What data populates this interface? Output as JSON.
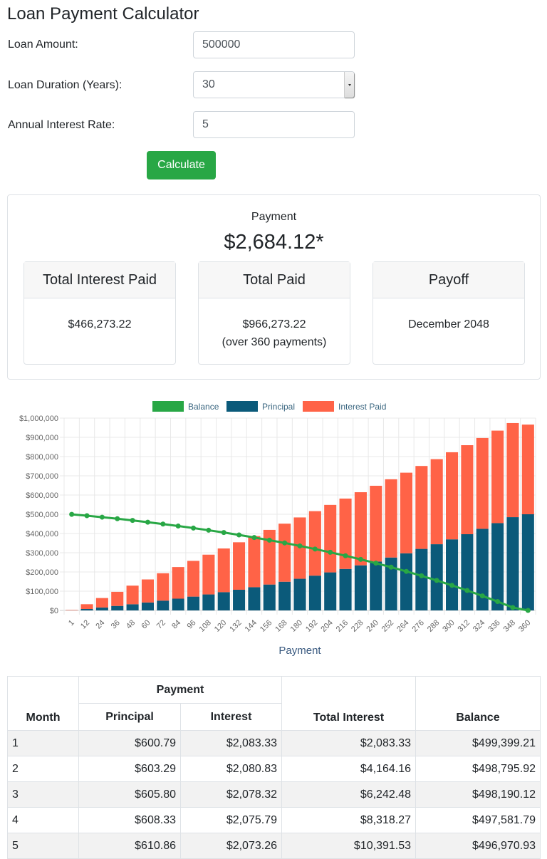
{
  "title": "Loan Payment Calculator",
  "form": {
    "amount_label": "Loan Amount:",
    "amount_value": "500000",
    "duration_label": "Loan Duration (Years):",
    "duration_value": "30",
    "rate_label": "Annual Interest Rate:",
    "rate_value": "5",
    "calculate_label": "Calculate"
  },
  "summary": {
    "payment_label": "Payment",
    "payment_value": "$2,684.12*",
    "cards": [
      {
        "header": "Total Interest Paid",
        "line1": "$466,273.22",
        "line2": ""
      },
      {
        "header": "Total Paid",
        "line1": "$966,273.22",
        "line2": "(over 360 payments)"
      },
      {
        "header": "Payoff",
        "line1": "December 2048",
        "line2": ""
      }
    ]
  },
  "chart_data": {
    "type": "bar",
    "stacked": true,
    "xlabel": "Payment",
    "ylabel": "",
    "ylim": [
      0,
      1000000
    ],
    "yticks": [
      "$0",
      "$100,000",
      "$200,000",
      "$300,000",
      "$400,000",
      "$500,000",
      "$600,000",
      "$700,000",
      "$800,000",
      "$900,000",
      "$1,000,000"
    ],
    "legend": "top",
    "grid": true,
    "categories": [
      "1",
      "12",
      "24",
      "36",
      "48",
      "60",
      "72",
      "84",
      "96",
      "108",
      "120",
      "132",
      "144",
      "156",
      "168",
      "180",
      "192",
      "204",
      "216",
      "228",
      "240",
      "252",
      "264",
      "276",
      "288",
      "300",
      "312",
      "324",
      "336",
      "348",
      "360"
    ],
    "series": [
      {
        "name": "Balance",
        "type": "line",
        "color": "#28a745",
        "values": [
          499399,
          492623,
          484869,
          476718,
          468000,
          458800,
          449100,
          438900,
          428200,
          416900,
          405000,
          392500,
          379300,
          365400,
          350800,
          335400,
          319200,
          302200,
          284300,
          265500,
          245700,
          224900,
          203000,
          180000,
          155800,
          130400,
          103700,
          75600,
          46100,
          15000,
          0
        ]
      },
      {
        "name": "Principal",
        "type": "bar",
        "color": "#0b5a7a",
        "values": [
          601,
          7377,
          15131,
          23282,
          32000,
          41200,
          50900,
          61100,
          71800,
          83100,
          95000,
          107500,
          120700,
          134600,
          149200,
          164600,
          180800,
          197800,
          215700,
          234500,
          254300,
          275100,
          297000,
          320000,
          344200,
          369600,
          396300,
          424400,
          453900,
          485000,
          500000
        ]
      },
      {
        "name": "Interest Paid",
        "type": "bar",
        "color": "#ff6347",
        "values": [
          2083,
          24832,
          49288,
          73346,
          96838,
          119847,
          142356,
          164365,
          185876,
          206785,
          227094,
          246804,
          265813,
          284222,
          301932,
          318942,
          335351,
          350912,
          365872,
          380133,
          393885,
          406844,
          419228,
          431106,
          442294,
          452858,
          462855,
          472213,
          480977,
          489256,
          466273
        ]
      }
    ]
  },
  "table": {
    "group_header": "Payment",
    "headers": [
      "Month",
      "Principal",
      "Interest",
      "Total Interest",
      "Balance"
    ],
    "rows": [
      [
        "1",
        "$600.79",
        "$2,083.33",
        "$2,083.33",
        "$499,399.21"
      ],
      [
        "2",
        "$603.29",
        "$2,080.83",
        "$4,164.16",
        "$498,795.92"
      ],
      [
        "3",
        "$605.80",
        "$2,078.32",
        "$6,242.48",
        "$498,190.12"
      ],
      [
        "4",
        "$608.33",
        "$2,075.79",
        "$8,318.27",
        "$497,581.79"
      ],
      [
        "5",
        "$610.86",
        "$2,073.26",
        "$10,391.53",
        "$496,970.93"
      ]
    ]
  }
}
